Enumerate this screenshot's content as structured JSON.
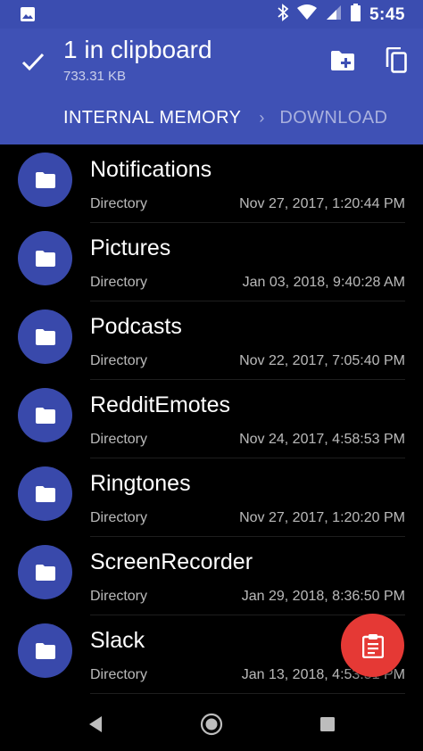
{
  "status_bar": {
    "time": "5:45",
    "icons": [
      "image-notification-icon",
      "bluetooth-icon",
      "wifi-icon",
      "cellular-signal-icon",
      "battery-icon"
    ]
  },
  "app_bar": {
    "title": "1 in clipboard",
    "subtitle": "733.31 KB",
    "breadcrumb": {
      "current": "INTERNAL MEMORY",
      "separator": "›",
      "next": "DOWNLOAD"
    },
    "colors": {
      "app_bar": "#3f51b5",
      "status_bar": "#3b4db0",
      "folder_avatar": "#3949ab",
      "fab": "#e53935"
    }
  },
  "files": [
    {
      "name": "Notifications",
      "type": "Directory",
      "date": "Nov 27, 2017, 1:20:44 PM"
    },
    {
      "name": "Pictures",
      "type": "Directory",
      "date": "Jan 03, 2018, 9:40:28 AM"
    },
    {
      "name": "Podcasts",
      "type": "Directory",
      "date": "Nov 22, 2017, 7:05:40 PM"
    },
    {
      "name": "RedditEmotes",
      "type": "Directory",
      "date": "Nov 24, 2017, 4:58:53 PM"
    },
    {
      "name": "Ringtones",
      "type": "Directory",
      "date": "Nov 27, 2017, 1:20:20 PM"
    },
    {
      "name": "ScreenRecorder",
      "type": "Directory",
      "date": "Jan 29, 2018, 8:36:50 PM"
    },
    {
      "name": "Slack",
      "type": "Directory",
      "date": "Jan 13, 2018, 4:53:51 PM"
    }
  ],
  "fab": {
    "icon": "paste-clipboard-icon"
  },
  "nav_bar": {
    "icons": [
      "back-icon",
      "home-icon",
      "recents-icon"
    ]
  }
}
